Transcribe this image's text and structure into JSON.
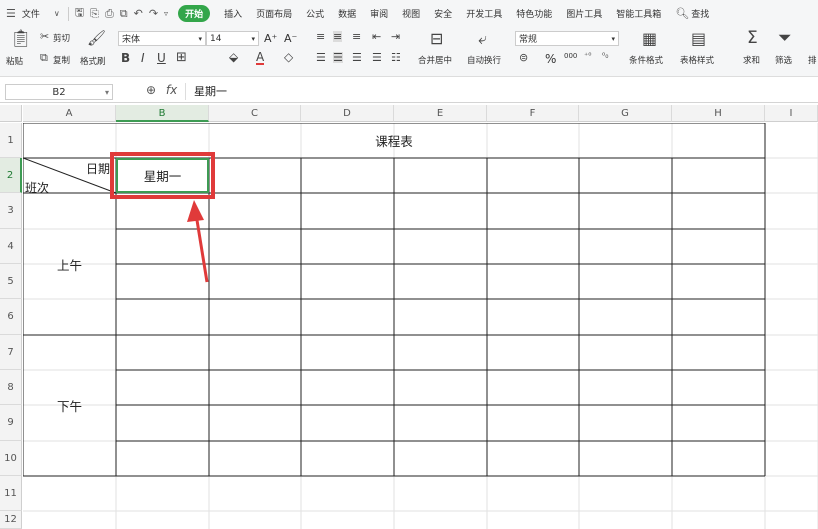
{
  "menubar": {
    "file": "文件",
    "tabs": [
      "开始",
      "插入",
      "页面布局",
      "公式",
      "数据",
      "审阅",
      "视图",
      "安全",
      "开发工具",
      "特色功能",
      "图片工具",
      "智能工具箱"
    ],
    "active_tab": "开始",
    "search": "查找"
  },
  "ribbon": {
    "paste": "粘贴",
    "cut": "剪切",
    "copy": "复制",
    "format_painter": "格式刷",
    "font_name": "宋体",
    "font_size": "14",
    "font_grow": "A⁺",
    "font_shrink": "A⁻",
    "merge_center": "合并居中",
    "wrap_text": "自动换行",
    "number_format": "常规",
    "percent": "%",
    "thousands": "000",
    "conditional_format": "条件格式",
    "table_style": "表格样式",
    "sum": "求和",
    "filter": "筛选",
    "sort": "排"
  },
  "formula_bar": {
    "cell_ref": "B2",
    "fx": "fx",
    "content": "星期一"
  },
  "columns": [
    "A",
    "B",
    "C",
    "D",
    "E",
    "F",
    "G",
    "H",
    "I"
  ],
  "rows": [
    "1",
    "2",
    "3",
    "4",
    "5",
    "6",
    "7",
    "8",
    "9",
    "10",
    "11",
    "12"
  ],
  "selected_cell": {
    "col": "B",
    "row": "2"
  },
  "sheet": {
    "title": "课程表",
    "diag_top": "日期",
    "diag_bottom": "班次",
    "b2": "星期一",
    "morning": "上午",
    "afternoon": "下午"
  },
  "colors": {
    "active_tab": "#33a64a",
    "selection": "#3d9b53",
    "highlight": "#e03a3a"
  }
}
